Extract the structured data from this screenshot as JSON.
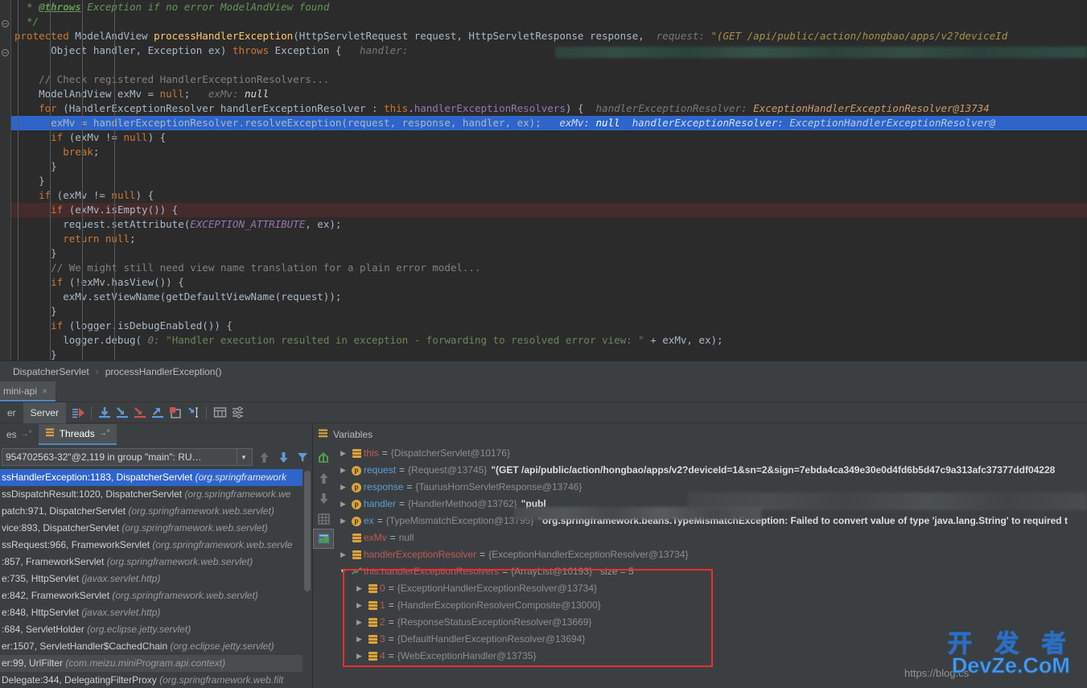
{
  "editor": {
    "lines": [
      {
        "id": "l1",
        "state": "normal",
        "segs": [
          {
            "t": "doc",
            "v": "  * "
          },
          {
            "t": "doctag",
            "v": "@throws"
          },
          {
            "t": "doc",
            "v": " Exception if no error ModelAndView found"
          }
        ]
      },
      {
        "id": "l2",
        "state": "normal",
        "segs": [
          {
            "t": "doc",
            "v": "  */"
          }
        ]
      },
      {
        "id": "l3",
        "state": "normal",
        "segs": [
          {
            "t": "kw",
            "v": "protected"
          },
          {
            "t": "plain",
            "v": " ModelAndView "
          },
          {
            "t": "meth",
            "v": "processHandlerException"
          },
          {
            "t": "plain",
            "v": "(HttpServletRequest request, HttpServletResponse response,  "
          },
          {
            "t": "hintk",
            "v": "request:"
          },
          {
            "t": "hintstr",
            "v": " \"(GET /api/public/action/hongbao/apps/v2?deviceId"
          }
        ]
      },
      {
        "id": "l4",
        "state": "normal",
        "segs": [
          {
            "t": "plain",
            "v": "      Object handler, Exception ex) "
          },
          {
            "t": "kw",
            "v": "throws"
          },
          {
            "t": "plain",
            "v": " Exception {   "
          },
          {
            "t": "hintk",
            "v": "handler:"
          }
        ]
      },
      {
        "id": "l5",
        "state": "normal",
        "segs": []
      },
      {
        "id": "l6",
        "state": "normal",
        "segs": [
          {
            "t": "cmt",
            "v": "    // Check registered HandlerExceptionResolvers..."
          }
        ]
      },
      {
        "id": "l7",
        "state": "normal",
        "segs": [
          {
            "t": "plain",
            "v": "    ModelAndView exMv = "
          },
          {
            "t": "kw",
            "v": "null"
          },
          {
            "t": "plain",
            "v": ";   "
          },
          {
            "t": "hintk",
            "v": "exMv:"
          },
          {
            "t": "hintnull",
            "v": " null"
          }
        ]
      },
      {
        "id": "l8",
        "state": "normal",
        "segs": [
          {
            "t": "kw",
            "v": "    for"
          },
          {
            "t": "plain",
            "v": " (HandlerExceptionResolver handlerExceptionResolver : "
          },
          {
            "t": "kw",
            "v": "this"
          },
          {
            "t": "plain",
            "v": "."
          },
          {
            "t": "fld",
            "v": "handlerExceptionResolvers"
          },
          {
            "t": "plain",
            "v": ") {  "
          },
          {
            "t": "hintk",
            "v": "handlerExceptionResolver:"
          },
          {
            "t": "hintv2",
            "v": " ExceptionHandlerExceptionResolver@13734"
          }
        ]
      },
      {
        "id": "l9",
        "state": "exec",
        "segs": [
          {
            "t": "plain",
            "v": "      exMv = handlerExceptionResolver.resolveException(request, response, handler, ex);   "
          },
          {
            "t": "hintk",
            "v": "exMv:"
          },
          {
            "t": "hintnull",
            "v": " null"
          },
          {
            "t": "hintk",
            "v": "  handlerExceptionResolver:"
          },
          {
            "t": "hintv2",
            "v": " ExceptionHandlerExceptionResolver@"
          }
        ]
      },
      {
        "id": "l10",
        "state": "normal",
        "segs": [
          {
            "t": "kw",
            "v": "      if"
          },
          {
            "t": "plain",
            "v": " (exMv != "
          },
          {
            "t": "kw",
            "v": "null"
          },
          {
            "t": "plain",
            "v": ") {"
          }
        ]
      },
      {
        "id": "l11",
        "state": "normal",
        "segs": [
          {
            "t": "kw",
            "v": "        break"
          },
          {
            "t": "plain",
            "v": ";"
          }
        ]
      },
      {
        "id": "l12",
        "state": "normal",
        "segs": [
          {
            "t": "plain",
            "v": "      }"
          }
        ]
      },
      {
        "id": "l13",
        "state": "normal",
        "segs": [
          {
            "t": "plain",
            "v": "    }"
          }
        ]
      },
      {
        "id": "l14",
        "state": "normal",
        "segs": [
          {
            "t": "kw",
            "v": "    if"
          },
          {
            "t": "plain",
            "v": " (exMv != "
          },
          {
            "t": "kw",
            "v": "null"
          },
          {
            "t": "plain",
            "v": ") {"
          }
        ]
      },
      {
        "id": "l15",
        "state": "err",
        "segs": [
          {
            "t": "kw",
            "v": "      if"
          },
          {
            "t": "plain",
            "v": " (exMv.isEmpty()) {"
          }
        ]
      },
      {
        "id": "l16",
        "state": "normal",
        "segs": [
          {
            "t": "plain",
            "v": "        request.setAttribute("
          },
          {
            "t": "cnst",
            "v": "EXCEPTION_ATTRIBUTE"
          },
          {
            "t": "plain",
            "v": ", ex);"
          }
        ]
      },
      {
        "id": "l17",
        "state": "normal",
        "segs": [
          {
            "t": "kw",
            "v": "        return null"
          },
          {
            "t": "plain",
            "v": ";"
          }
        ]
      },
      {
        "id": "l18",
        "state": "normal",
        "segs": [
          {
            "t": "plain",
            "v": "      }"
          }
        ]
      },
      {
        "id": "l19",
        "state": "normal",
        "segs": [
          {
            "t": "cmt",
            "v": "      // We might still need view name translation for a plain error model..."
          }
        ]
      },
      {
        "id": "l20",
        "state": "normal",
        "segs": [
          {
            "t": "kw",
            "v": "      if"
          },
          {
            "t": "plain",
            "v": " (!exMv.hasView()) {"
          }
        ]
      },
      {
        "id": "l21",
        "state": "normal",
        "segs": [
          {
            "t": "plain",
            "v": "        exMv.setViewName(getDefaultViewName(request));"
          }
        ]
      },
      {
        "id": "l22",
        "state": "normal",
        "segs": [
          {
            "t": "plain",
            "v": "      }"
          }
        ]
      },
      {
        "id": "l23",
        "state": "normal",
        "segs": [
          {
            "t": "kw",
            "v": "      if"
          },
          {
            "t": "plain",
            "v": " (logger.isDebugEnabled()) {"
          }
        ]
      },
      {
        "id": "l24",
        "state": "normal",
        "segs": [
          {
            "t": "plain",
            "v": "        logger.debug( "
          },
          {
            "t": "hintk",
            "v": "0:"
          },
          {
            "t": "str",
            "v": " \"Handler execution resulted in exception - forwarding to resolved error view: \""
          },
          {
            "t": "plain",
            "v": " + exMv, ex);"
          }
        ]
      },
      {
        "id": "l25",
        "state": "normal",
        "segs": [
          {
            "t": "plain",
            "v": "      }"
          }
        ]
      }
    ],
    "smudge_note": "obscured-request-value"
  },
  "breadcrumb": {
    "class": "DispatcherServlet",
    "separator": "›",
    "method": "processHandlerException()"
  },
  "run_tabs": [
    {
      "label": "mini-api",
      "close": "×"
    }
  ],
  "debug_toolbar": {
    "tabs": [
      {
        "label": "er",
        "selected": false
      },
      {
        "label": "Server",
        "selected": true
      }
    ],
    "icons": [
      {
        "name": "show-execution-point-icon"
      },
      {
        "name": "step-over-icon"
      },
      {
        "name": "step-into-icon"
      },
      {
        "name": "force-step-into-icon"
      },
      {
        "name": "step-out-icon"
      },
      {
        "name": "drop-frame-icon"
      },
      {
        "name": "run-to-cursor-icon"
      },
      {
        "name": "evaluate-expression-icon"
      },
      {
        "name": "settings-icon"
      }
    ]
  },
  "frames_panel": {
    "tabs": [
      {
        "label": "es",
        "selected": false,
        "pin": "→°"
      },
      {
        "label": "Threads",
        "selected": true,
        "pin": "→°"
      }
    ],
    "thread_combo_value": "954702563-32\"@2,119 in group \"main\": RU…",
    "toolbar_icons": [
      {
        "name": "frame-up-icon"
      },
      {
        "name": "frame-down-icon"
      },
      {
        "name": "filter-icon"
      }
    ],
    "frames": [
      {
        "method": "ssHandlerException:1183, DispatcherServlet",
        "pkg": "(org.springframework",
        "state": "selected"
      },
      {
        "method": "ssDispatchResult:1020, DispatcherServlet",
        "pkg": "(org.springframework.we",
        "state": "normal"
      },
      {
        "method": "patch:971, DispatcherServlet",
        "pkg": "(org.springframework.web.servlet)",
        "state": "normal"
      },
      {
        "method": "vice:893, DispatcherServlet",
        "pkg": "(org.springframework.web.servlet)",
        "state": "normal"
      },
      {
        "method": "ssRequest:966, FrameworkServlet",
        "pkg": "(org.springframework.web.servle",
        "state": "normal"
      },
      {
        "method": ":857, FrameworkServlet",
        "pkg": "(org.springframework.web.servlet)",
        "state": "normal"
      },
      {
        "method": "e:735, HttpServlet",
        "pkg": "(javax.servlet.http)",
        "state": "normal"
      },
      {
        "method": "e:842, FrameworkServlet",
        "pkg": "(org.springframework.web.servlet)",
        "state": "normal"
      },
      {
        "method": "e:848, HttpServlet",
        "pkg": "(javax.servlet.http)",
        "state": "normal"
      },
      {
        "method": ":684, ServletHolder",
        "pkg": "(org.eclipse.jetty.servlet)",
        "state": "normal"
      },
      {
        "method": "er:1507, ServletHandler$CachedChain",
        "pkg": "(org.eclipse.jetty.servlet)",
        "state": "normal"
      },
      {
        "method": "er:99, UrlFilter",
        "pkg": "(com.meizu.miniProgram.api.context)",
        "state": "hover"
      },
      {
        "method": "Delegate:344, DelegatingFilterProxy",
        "pkg": "(org.springframework.web.filt",
        "state": "normal"
      }
    ]
  },
  "variables_panel": {
    "title": "Variables",
    "toolbar_icons": [
      {
        "name": "show-referring-objects-icon"
      },
      {
        "name": "move-up-icon"
      },
      {
        "name": "move-down-icon"
      },
      {
        "name": "customize-data-views-icon"
      },
      {
        "name": "inline-watches-icon",
        "selected": true
      }
    ],
    "rows": [
      {
        "indent": 0,
        "arrow": "collapsed",
        "icon": "object",
        "name": "this",
        "name_kind": "local",
        "eq": "=",
        "value": "{DispatcherServlet@10176}",
        "str": "",
        "size": ""
      },
      {
        "indent": 0,
        "arrow": "collapsed",
        "icon": "param",
        "name": "request",
        "name_kind": "param",
        "eq": "=",
        "value": "{Request@13745}",
        "str": "\"(GET /api/public/action/hongbao/apps/v2?deviceId=1&sn=2&sign=7ebda4ca349e30e0d4fd6b5d47c9a313afc37377ddf04228",
        "size": ""
      },
      {
        "indent": 0,
        "arrow": "collapsed",
        "icon": "param",
        "name": "response",
        "name_kind": "param",
        "eq": "=",
        "value": "{TaurusHornServletResponse@13746}",
        "str": "",
        "size": ""
      },
      {
        "indent": 0,
        "arrow": "collapsed",
        "icon": "param",
        "name": "handler",
        "name_kind": "param",
        "eq": "=",
        "value": "{HandlerMethod@13762}",
        "str": "\"publ",
        "size": ""
      },
      {
        "indent": 0,
        "arrow": "collapsed",
        "icon": "param",
        "name": "ex",
        "name_kind": "param",
        "eq": "=",
        "value": "{TypeMismatchException@13795}",
        "str": "\"org.springframework.beans.TypeMismatchException: Failed to convert value of type 'java.lang.String' to required t",
        "size": ""
      },
      {
        "indent": 0,
        "arrow": "none",
        "icon": "object",
        "name": "exMv",
        "name_kind": "local",
        "eq": "=",
        "value": "null",
        "str": "",
        "size": ""
      },
      {
        "indent": 0,
        "arrow": "collapsed",
        "icon": "object",
        "name": "handlerExceptionResolver",
        "name_kind": "local",
        "eq": "=",
        "value": "{ExceptionHandlerExceptionResolver@13734}",
        "str": "",
        "size": ""
      },
      {
        "indent": 0,
        "arrow": "expanded",
        "icon": "watch",
        "name": "this.handlerExceptionResolvers",
        "name_kind": "watch",
        "eq": "=",
        "value": "{ArrayList@10193}",
        "str": "",
        "size": "size = 5"
      },
      {
        "indent": 1,
        "arrow": "collapsed",
        "icon": "object",
        "name": "0",
        "name_kind": "index",
        "eq": "=",
        "value": "{ExceptionHandlerExceptionResolver@13734}",
        "str": "",
        "size": ""
      },
      {
        "indent": 1,
        "arrow": "collapsed",
        "icon": "object",
        "name": "1",
        "name_kind": "index",
        "eq": "=",
        "value": "{HandlerExceptionResolverComposite@13000}",
        "str": "",
        "size": ""
      },
      {
        "indent": 1,
        "arrow": "collapsed",
        "icon": "object",
        "name": "2",
        "name_kind": "index",
        "eq": "=",
        "value": "{ResponseStatusExceptionResolver@13669}",
        "str": "",
        "size": ""
      },
      {
        "indent": 1,
        "arrow": "collapsed",
        "icon": "object",
        "name": "3",
        "name_kind": "index",
        "eq": "=",
        "value": "{DefaultHandlerExceptionResolver@13694}",
        "str": "",
        "size": ""
      },
      {
        "indent": 1,
        "arrow": "collapsed",
        "icon": "object",
        "name": "4",
        "name_kind": "index",
        "eq": "=",
        "value": "{WebExceptionHandler@13735}",
        "str": "",
        "size": ""
      }
    ]
  },
  "annotation": {
    "name": "red-highlight-box",
    "color": "#ef2d2d"
  },
  "watermark": {
    "url_text": "https://blog.cs",
    "cn": "开 发 者",
    "en": "DevZe.CoM"
  },
  "colors": {
    "editor_bg": "#2b2b2b",
    "panel_bg": "#3c3f41",
    "exec_line": "#2f65ca",
    "error_line": "#452b2b",
    "accent": "#4a88c7",
    "annotation": "#ef2d2d"
  }
}
